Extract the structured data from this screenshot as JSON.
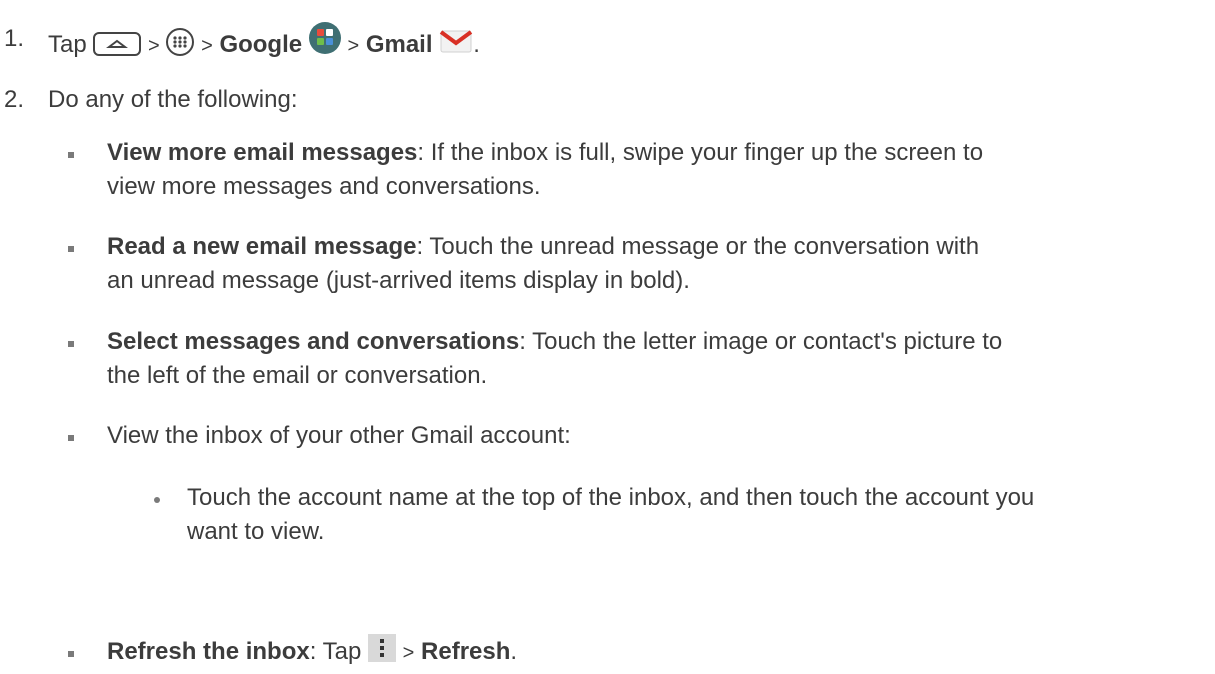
{
  "step1": {
    "number": "1.",
    "text_tap": "Tap",
    "sep": ">",
    "google_label": "Google",
    "gmail_label": "Gmail",
    "end": ".",
    "icons": [
      "home-key-icon",
      "apps-icon",
      "google-folder-icon",
      "gmail-icon"
    ]
  },
  "step2": {
    "number": "2.",
    "text": "Do any of the following:"
  },
  "bullets": [
    {
      "bold": "View more email messages",
      "line1": ": If the inbox is full, swipe your finger up the screen to",
      "line2": "view more messages and conversations."
    },
    {
      "bold": "Read a new email message",
      "line1": ": Touch the unread message or the conversation with",
      "line2": "an unread message (just-arrived items display in bold)."
    },
    {
      "bold": "Select messages and conversations",
      "line1": ": Touch the letter image or contact's picture to",
      "line2": "the left of the email or conversation."
    },
    {
      "text": "View the inbox of your other Gmail account:"
    }
  ],
  "sub_bullet": {
    "line1": "Touch the account name at the top of the inbox, and then touch the account you",
    "line2": "want to view."
  },
  "last_bullet": {
    "bold": "Refresh the inbox",
    "text_tap": ": Tap",
    "sep": ">",
    "refresh_label": "Refresh",
    "end": ".",
    "icon": "menu-icon"
  }
}
